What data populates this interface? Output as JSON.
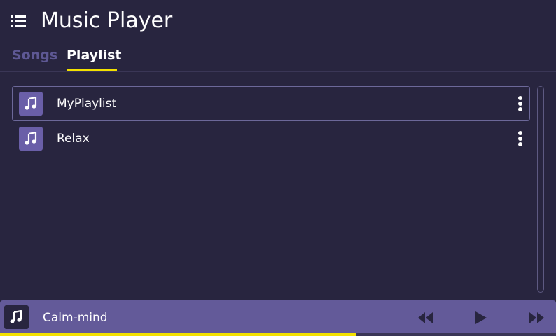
{
  "app": {
    "title": "Music Player",
    "icons": {
      "menu": "menu-icon",
      "music_note": "music-note-icon",
      "more": "more-vertical-icon",
      "previous": "rewind-icon",
      "play": "play-icon",
      "next": "fast-forward-icon"
    },
    "colors": {
      "background": "#28253f",
      "accent": "#f3e100",
      "player_bar": "#635a99",
      "icon_tile": "#6a5fa8",
      "inactive_tab": "#5e5894"
    }
  },
  "tabs": [
    {
      "label": "Songs",
      "active": false
    },
    {
      "label": "Playlist",
      "active": true
    }
  ],
  "playlists": [
    {
      "label": "MyPlaylist",
      "selected": true
    },
    {
      "label": "Relax",
      "selected": false
    }
  ],
  "player": {
    "now_playing": "Calm-mind",
    "progress_fraction": 0.64,
    "state": "paused"
  }
}
